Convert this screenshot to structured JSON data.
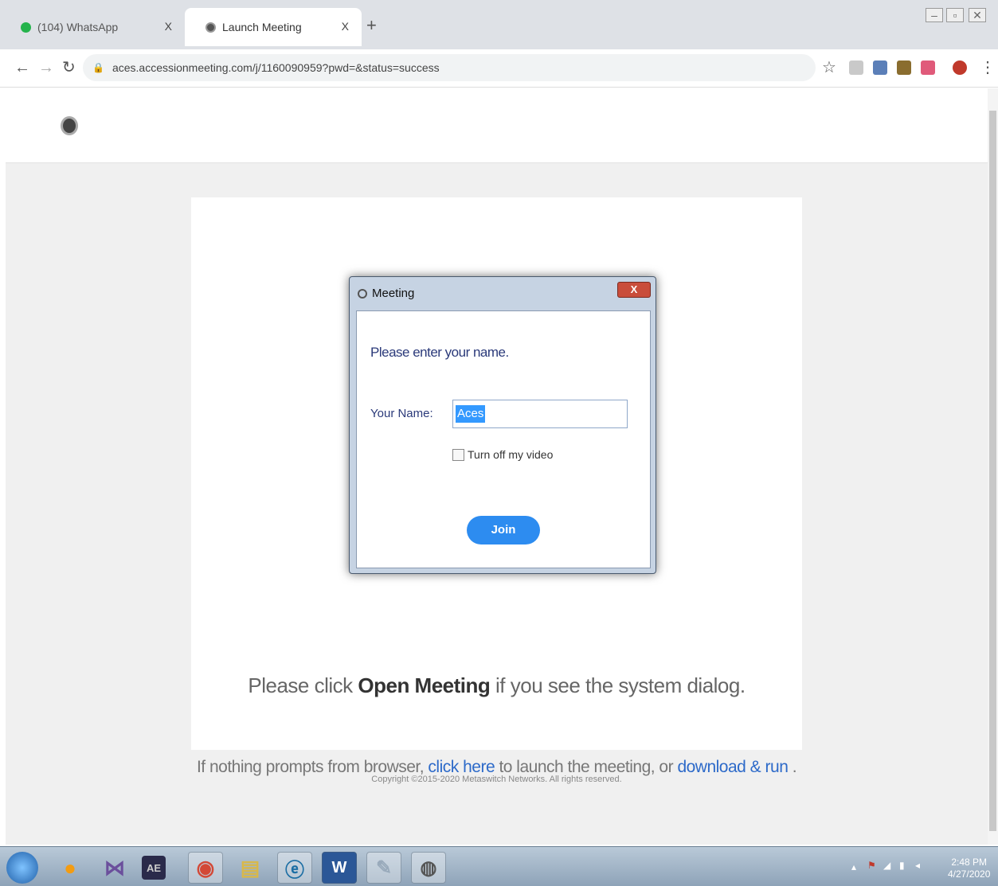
{
  "browser": {
    "tabs": [
      {
        "label": "(104) WhatsApp",
        "close": "X"
      },
      {
        "label": "Launch Meeting",
        "close": "X"
      }
    ],
    "new_tab": "+",
    "url": "aces.accessionmeeting.com/j/1160090959?pwd=&status=success"
  },
  "page": {
    "prompt_before": "Please click ",
    "prompt_bold": "Open Meeting",
    "prompt_after": " if you see the system dialog.",
    "launch_before": "If nothing prompts from browser, ",
    "launch_link1": "click here",
    "launch_middle": " to launch the meeting, or ",
    "launch_link2": "download & run",
    "launch_after": " .",
    "copyright": "Copyright ©2015-2020 Metaswitch Networks. All rights reserved."
  },
  "dialog": {
    "title": "Meeting",
    "close": "X",
    "heading": "Please enter your name.",
    "name_label": "Your Name:",
    "name_value": "Aces",
    "checkbox_label": "Turn off my video",
    "checkbox_checked": false,
    "join_label": "Join"
  },
  "taskbar": {
    "time": "2:48 PM",
    "date": "4/27/2020"
  },
  "colors": {
    "link": "#2d6ac9",
    "join_button": "#2d8cf0",
    "selection": "#3399ff"
  }
}
